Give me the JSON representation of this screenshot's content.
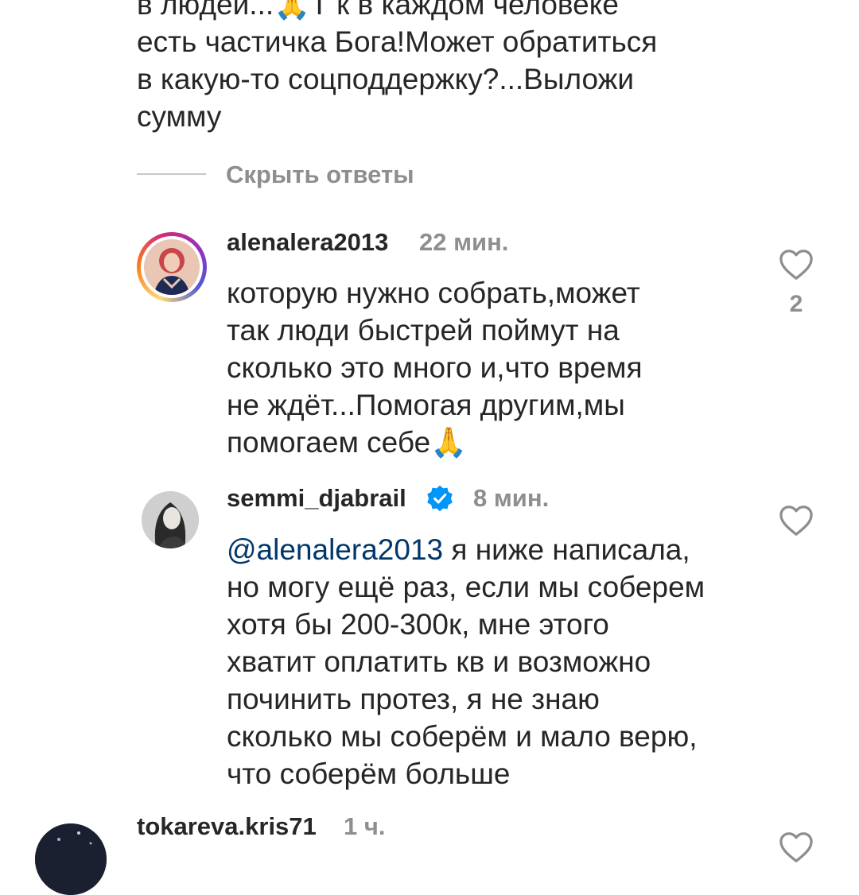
{
  "parent_comment": {
    "text": "в людей...🙏Т к в каждом человеке\nесть частичка Бога!Может обратиться\nв какую-то соцподдержку?...Выложи\nсумму"
  },
  "hide_replies": {
    "label": "Скрыть ответы"
  },
  "replies": [
    {
      "username": "alenalera2013",
      "time": "22 мин.",
      "text": "которую нужно собрать,может\nтак люди быстрей поймут на\nсколько это много и,что время\nне ждёт...Помогая другим,мы\nпомогаем себе🙏",
      "like_count": "2",
      "has_story_ring": true
    },
    {
      "username": "semmi_djabrail",
      "verified": true,
      "time": "8 мин.",
      "mention": "@alenalera2013",
      "text": " я ниже написала,\nно могу ещё раз, если мы соберем\nхотя бы 200-300к, мне этого\nхватит оплатить кв и возможно\nпочинить протез, я не знаю\nсколько мы соберём и мало верю,\nчто соберём больше",
      "like_count": ""
    },
    {
      "username": "tokareva.kris71",
      "time": "1 ч."
    }
  ],
  "colors": {
    "text": "#262626",
    "secondary": "#8e8e8e",
    "mention": "#00376b",
    "verified": "#0095f6"
  },
  "icons": {
    "like": "heart-outline-icon",
    "verified": "verified-badge-icon"
  }
}
